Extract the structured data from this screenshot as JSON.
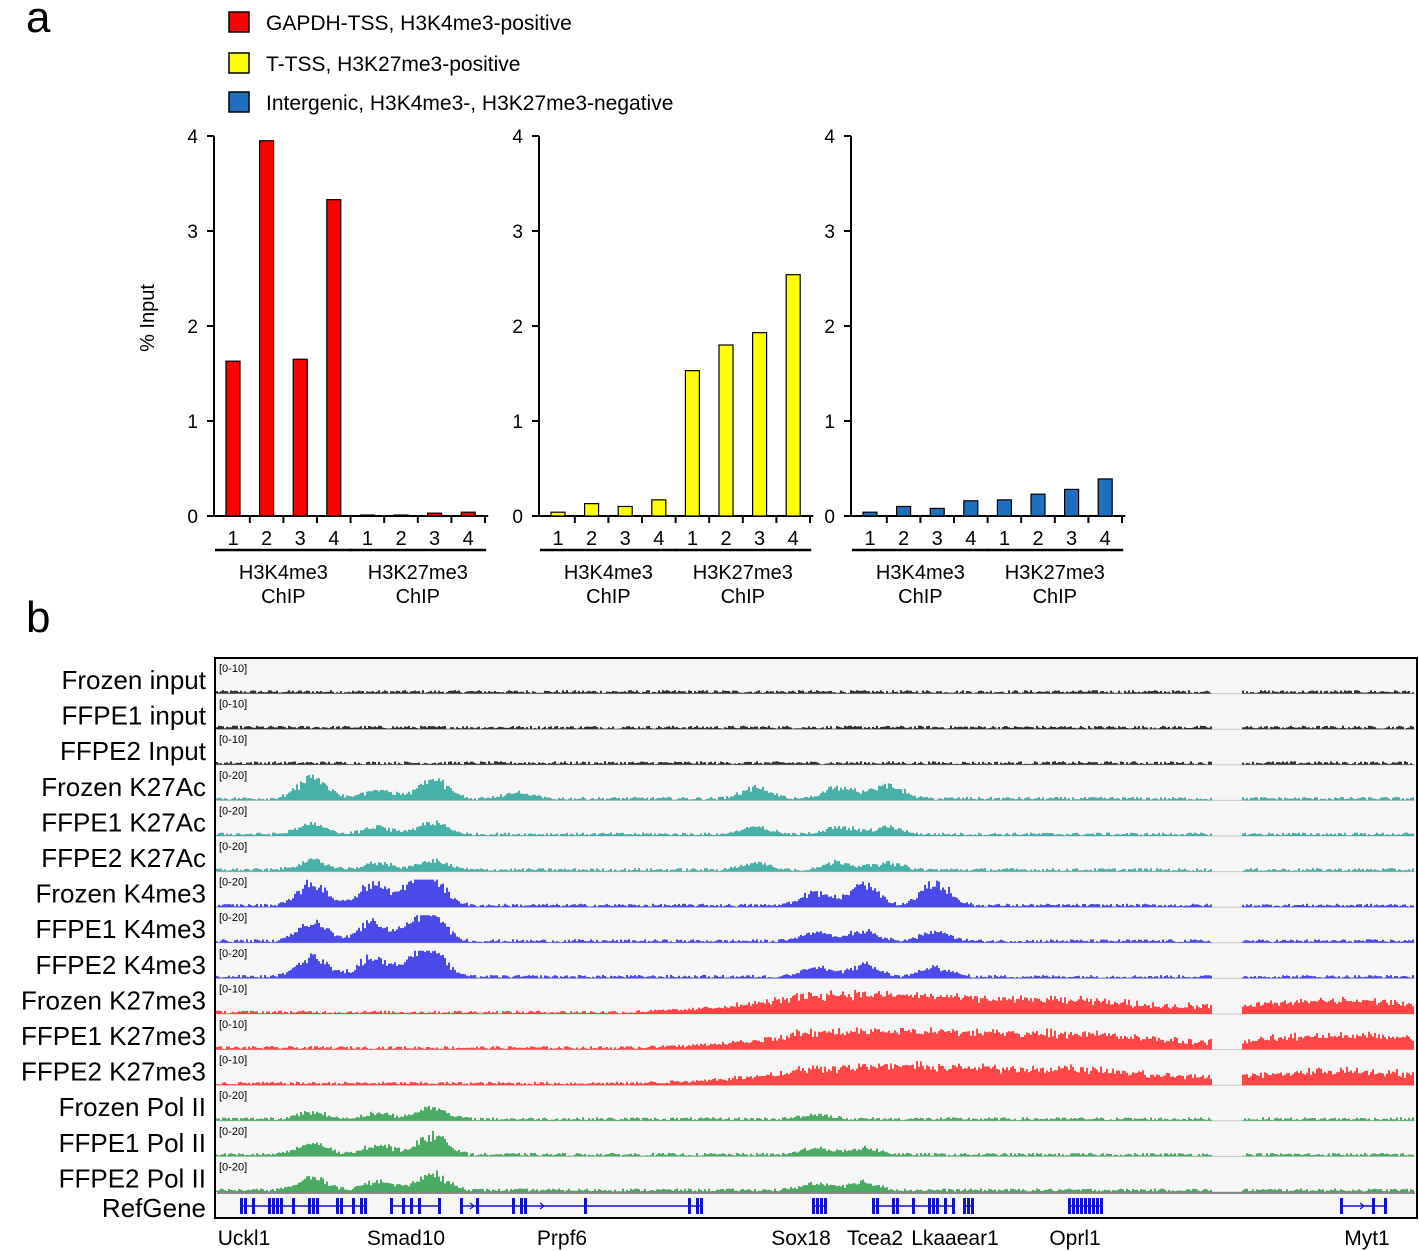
{
  "panel_a": {
    "letter": "a",
    "legend": [
      {
        "label": "GAPDH-TSS, H3K4me3-positive",
        "color": "#ff0000"
      },
      {
        "label": "T-TSS, H3K27me3-positive",
        "color": "#ffff00"
      },
      {
        "label": "Intergenic, H3K4me3-, H3K27me3-negative",
        "color": "#1f6fbf"
      }
    ],
    "ylabel": "% Input",
    "y_ticks": [
      "0",
      "1",
      "2",
      "3",
      "4"
    ]
  },
  "chart_data": [
    {
      "type": "bar",
      "ylim": [
        0,
        4
      ],
      "ylabel": "% Input",
      "color": "#ff0000",
      "categories": [
        "1",
        "2",
        "3",
        "4",
        "1",
        "2",
        "3",
        "4"
      ],
      "groups": [
        {
          "label": "H3K4me3\nChIP"
        },
        {
          "label": "H3K27me3\nChIP"
        }
      ],
      "series": [
        {
          "name": "GAPDH-TSS, H3K4me3-positive",
          "values": [
            1.63,
            3.95,
            1.65,
            3.33,
            0.01,
            0.01,
            0.03,
            0.04
          ]
        }
      ]
    },
    {
      "type": "bar",
      "ylim": [
        0,
        4
      ],
      "color": "#ffff00",
      "categories": [
        "1",
        "2",
        "3",
        "4",
        "1",
        "2",
        "3",
        "4"
      ],
      "groups": [
        {
          "label": "H3K4me3\nChIP"
        },
        {
          "label": "H3K27me3\nChIP"
        }
      ],
      "series": [
        {
          "name": "T-TSS, H3K27me3-positive",
          "values": [
            0.04,
            0.13,
            0.1,
            0.17,
            1.53,
            1.8,
            1.93,
            2.54
          ]
        }
      ]
    },
    {
      "type": "bar",
      "ylim": [
        0,
        4
      ],
      "color": "#1f6fbf",
      "categories": [
        "1",
        "2",
        "3",
        "4",
        "1",
        "2",
        "3",
        "4"
      ],
      "groups": [
        {
          "label": "H3K4me3\nChIP"
        },
        {
          "label": "H3K27me3\nChIP"
        }
      ],
      "series": [
        {
          "name": "Intergenic, H3K4me3-, H3K27me3-negative",
          "values": [
            0.04,
            0.1,
            0.08,
            0.16,
            0.17,
            0.23,
            0.28,
            0.39
          ]
        }
      ]
    }
  ],
  "panel_b": {
    "letter": "b",
    "tracks": [
      {
        "label": "Frozen input",
        "range": "[0-10]",
        "color": "#000000",
        "peaks": []
      },
      {
        "label": "FFPE1 input",
        "range": "[0-10]",
        "color": "#000000",
        "peaks": []
      },
      {
        "label": "FFPE2 Input",
        "range": "[0-10]",
        "color": "#000000",
        "peaks": []
      },
      {
        "label": "Frozen K27Ac",
        "range": "[0-20]",
        "color": "#1a9e96",
        "peaks": [
          [
            0.08,
            0.9
          ],
          [
            0.135,
            0.4
          ],
          [
            0.18,
            0.85
          ],
          [
            0.25,
            0.25
          ],
          [
            0.45,
            0.45
          ],
          [
            0.52,
            0.55
          ],
          [
            0.56,
            0.6
          ]
        ]
      },
      {
        "label": "FFPE1 K27Ac",
        "range": "[0-20]",
        "color": "#1a9e96",
        "peaks": [
          [
            0.08,
            0.45
          ],
          [
            0.135,
            0.3
          ],
          [
            0.18,
            0.5
          ],
          [
            0.45,
            0.3
          ],
          [
            0.52,
            0.35
          ],
          [
            0.56,
            0.3
          ]
        ]
      },
      {
        "label": "FFPE2 K27Ac",
        "range": "[0-20]",
        "color": "#1a9e96",
        "peaks": [
          [
            0.08,
            0.4
          ],
          [
            0.135,
            0.3
          ],
          [
            0.18,
            0.4
          ],
          [
            0.45,
            0.3
          ],
          [
            0.52,
            0.35
          ],
          [
            0.56,
            0.3
          ]
        ]
      },
      {
        "label": "Frozen K4me3",
        "range": "[0-20]",
        "color": "#1f1fe6",
        "peaks": [
          [
            0.08,
            0.95
          ],
          [
            0.13,
            0.95
          ],
          [
            0.165,
            0.8
          ],
          [
            0.18,
            0.95
          ],
          [
            0.5,
            0.6
          ],
          [
            0.54,
            0.9
          ],
          [
            0.6,
            0.95
          ]
        ]
      },
      {
        "label": "FFPE1 K4me3",
        "range": "[0-20]",
        "color": "#1f1fe6",
        "peaks": [
          [
            0.08,
            0.85
          ],
          [
            0.13,
            0.8
          ],
          [
            0.165,
            0.6
          ],
          [
            0.18,
            0.9
          ],
          [
            0.5,
            0.4
          ],
          [
            0.54,
            0.45
          ],
          [
            0.6,
            0.4
          ]
        ]
      },
      {
        "label": "FFPE2 K4me3",
        "range": "[0-20]",
        "color": "#1f1fe6",
        "peaks": [
          [
            0.08,
            0.9
          ],
          [
            0.13,
            0.85
          ],
          [
            0.165,
            0.6
          ],
          [
            0.18,
            0.95
          ],
          [
            0.5,
            0.4
          ],
          [
            0.54,
            0.5
          ],
          [
            0.6,
            0.4
          ]
        ]
      },
      {
        "label": "Frozen K27me3",
        "range": "[0-10]",
        "color": "#ff1a1a",
        "peaks": [
          [
            0.5,
            0.55
          ],
          [
            0.6,
            0.4
          ],
          [
            0.72,
            0.35
          ],
          [
            0.94,
            0.4
          ]
        ]
      },
      {
        "label": "FFPE1 K27me3",
        "range": "[0-10]",
        "color": "#ff1a1a",
        "peaks": [
          [
            0.5,
            0.45
          ],
          [
            0.6,
            0.45
          ],
          [
            0.72,
            0.45
          ],
          [
            0.94,
            0.45
          ]
        ]
      },
      {
        "label": "FFPE2 K27me3",
        "range": "[0-10]",
        "color": "#ff1a1a",
        "peaks": [
          [
            0.5,
            0.45
          ],
          [
            0.6,
            0.45
          ],
          [
            0.72,
            0.45
          ],
          [
            0.94,
            0.45
          ]
        ]
      },
      {
        "label": "Frozen Pol II",
        "range": "[0-20]",
        "color": "#1e9a3e",
        "peaks": [
          [
            0.08,
            0.3
          ],
          [
            0.135,
            0.25
          ],
          [
            0.18,
            0.5
          ],
          [
            0.5,
            0.2
          ]
        ]
      },
      {
        "label": "FFPE1 Pol II",
        "range": "[0-20]",
        "color": "#1e9a3e",
        "peaks": [
          [
            0.08,
            0.5
          ],
          [
            0.135,
            0.45
          ],
          [
            0.18,
            0.85
          ],
          [
            0.5,
            0.3
          ],
          [
            0.54,
            0.3
          ]
        ]
      },
      {
        "label": "FFPE2 Pol II",
        "range": "[0-20]",
        "color": "#1e9a3e",
        "peaks": [
          [
            0.08,
            0.55
          ],
          [
            0.135,
            0.4
          ],
          [
            0.18,
            0.7
          ],
          [
            0.5,
            0.3
          ],
          [
            0.54,
            0.35
          ]
        ]
      }
    ],
    "refgene_label": "RefGene",
    "genes": [
      {
        "label": "Uckl1"
      },
      {
        "label": "Smad10"
      },
      {
        "label": "Prpf6"
      },
      {
        "label": "Sox18"
      },
      {
        "label": "Tcea2"
      },
      {
        "label": "Lkaaear1"
      },
      {
        "label": "Oprl1"
      },
      {
        "label": "Myt1"
      }
    ]
  }
}
